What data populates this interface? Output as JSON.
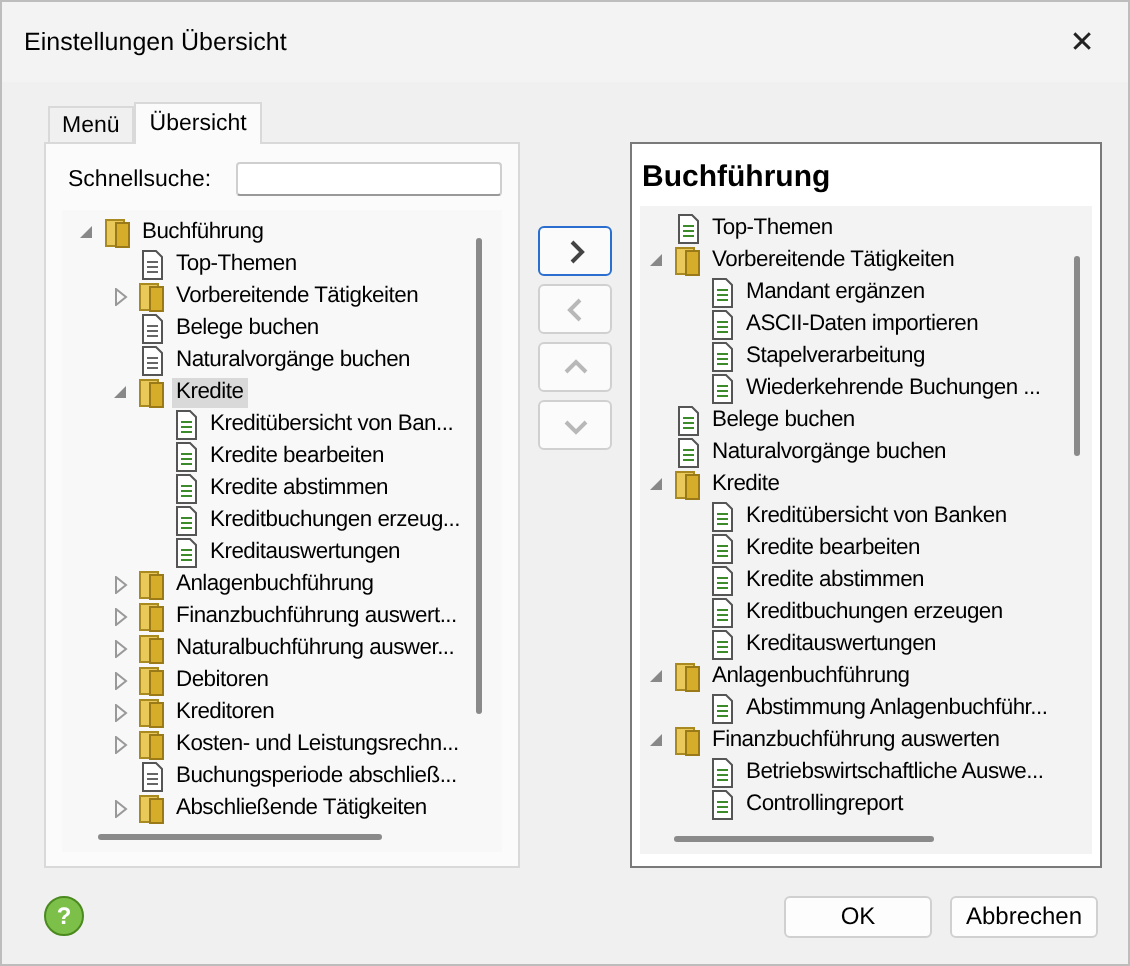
{
  "window": {
    "title": "Einstellungen Übersicht",
    "close": "✕"
  },
  "tabs": [
    {
      "label": "Menü",
      "selected": false
    },
    {
      "label": "Übersicht",
      "selected": true
    }
  ],
  "search": {
    "label": "Schnellsuche:"
  },
  "left_tree": [
    {
      "label": "Buchführung",
      "kind": "folder",
      "expanded": true,
      "selected": false,
      "children": [
        {
          "label": "Top-Themen",
          "kind": "page",
          "selected": false
        },
        {
          "label": "Vorbereitende Tätigkeiten",
          "kind": "folder",
          "expanded": false,
          "selected": false
        },
        {
          "label": "Belege buchen",
          "kind": "page",
          "selected": false
        },
        {
          "label": "Naturalvorgänge buchen",
          "kind": "page",
          "selected": false
        },
        {
          "label": "Kredite",
          "kind": "folder",
          "expanded": true,
          "selected": true,
          "children": [
            {
              "label": "Kreditübersicht von Ban...",
              "kind": "page-green",
              "selected": false
            },
            {
              "label": "Kredite bearbeiten",
              "kind": "page-green",
              "selected": false
            },
            {
              "label": "Kredite abstimmen",
              "kind": "page-green",
              "selected": false
            },
            {
              "label": "Kreditbuchungen erzeug...",
              "kind": "page-green",
              "selected": false
            },
            {
              "label": "Kreditauswertungen",
              "kind": "page-green",
              "selected": false
            }
          ]
        },
        {
          "label": "Anlagenbuchführung",
          "kind": "folder",
          "expanded": false,
          "selected": false
        },
        {
          "label": "Finanzbuchführung auswert...",
          "kind": "folder",
          "expanded": false,
          "selected": false
        },
        {
          "label": "Naturalbuchführung auswer...",
          "kind": "folder",
          "expanded": false,
          "selected": false
        },
        {
          "label": "Debitoren",
          "kind": "folder",
          "expanded": false,
          "selected": false
        },
        {
          "label": "Kreditoren",
          "kind": "folder",
          "expanded": false,
          "selected": false
        },
        {
          "label": "Kosten- und Leistungsrechn...",
          "kind": "folder",
          "expanded": false,
          "selected": false
        },
        {
          "label": "Buchungsperiode abschließ...",
          "kind": "page",
          "selected": false
        },
        {
          "label": "Abschließende Tätigkeiten",
          "kind": "folder",
          "expanded": false,
          "selected": false
        }
      ]
    }
  ],
  "move_buttons": [
    {
      "kind": "right",
      "disabled": false
    },
    {
      "kind": "left",
      "disabled": true
    },
    {
      "kind": "up",
      "disabled": true
    },
    {
      "kind": "down",
      "disabled": true
    }
  ],
  "right_panel": {
    "title": "Buchführung",
    "tree": [
      {
        "label": "Top-Themen",
        "kind": "page-green"
      },
      {
        "label": "Vorbereitende Tätigkeiten",
        "kind": "folder",
        "expanded": true,
        "children": [
          {
            "label": "Mandant ergänzen",
            "kind": "page-green"
          },
          {
            "label": "ASCII-Daten importieren",
            "kind": "page-green"
          },
          {
            "label": "Stapelverarbeitung",
            "kind": "page-green"
          },
          {
            "label": "Wiederkehrende Buchungen ...",
            "kind": "page-green"
          }
        ]
      },
      {
        "label": "Belege buchen",
        "kind": "page-green"
      },
      {
        "label": "Naturalvorgänge buchen",
        "kind": "page-green"
      },
      {
        "label": "Kredite",
        "kind": "folder",
        "expanded": true,
        "children": [
          {
            "label": "Kreditübersicht von Banken",
            "kind": "page-green"
          },
          {
            "label": "Kredite bearbeiten",
            "kind": "page-green"
          },
          {
            "label": "Kredite abstimmen",
            "kind": "page-green"
          },
          {
            "label": "Kreditbuchungen erzeugen",
            "kind": "page-green"
          },
          {
            "label": "Kreditauswertungen",
            "kind": "page-green"
          }
        ]
      },
      {
        "label": "Anlagenbuchführung",
        "kind": "folder",
        "expanded": true,
        "children": [
          {
            "label": "Abstimmung Anlagenbuchführ...",
            "kind": "page-green"
          }
        ]
      },
      {
        "label": "Finanzbuchführung auswerten",
        "kind": "folder",
        "expanded": true,
        "children": [
          {
            "label": "Betriebswirtschaftliche Auswe...",
            "kind": "page-green"
          },
          {
            "label": "Controllingreport",
            "kind": "page-green"
          }
        ]
      }
    ]
  },
  "help_button": {
    "label": "?"
  },
  "buttons": [
    {
      "label": "OK"
    },
    {
      "label": "Abbrechen"
    }
  ]
}
